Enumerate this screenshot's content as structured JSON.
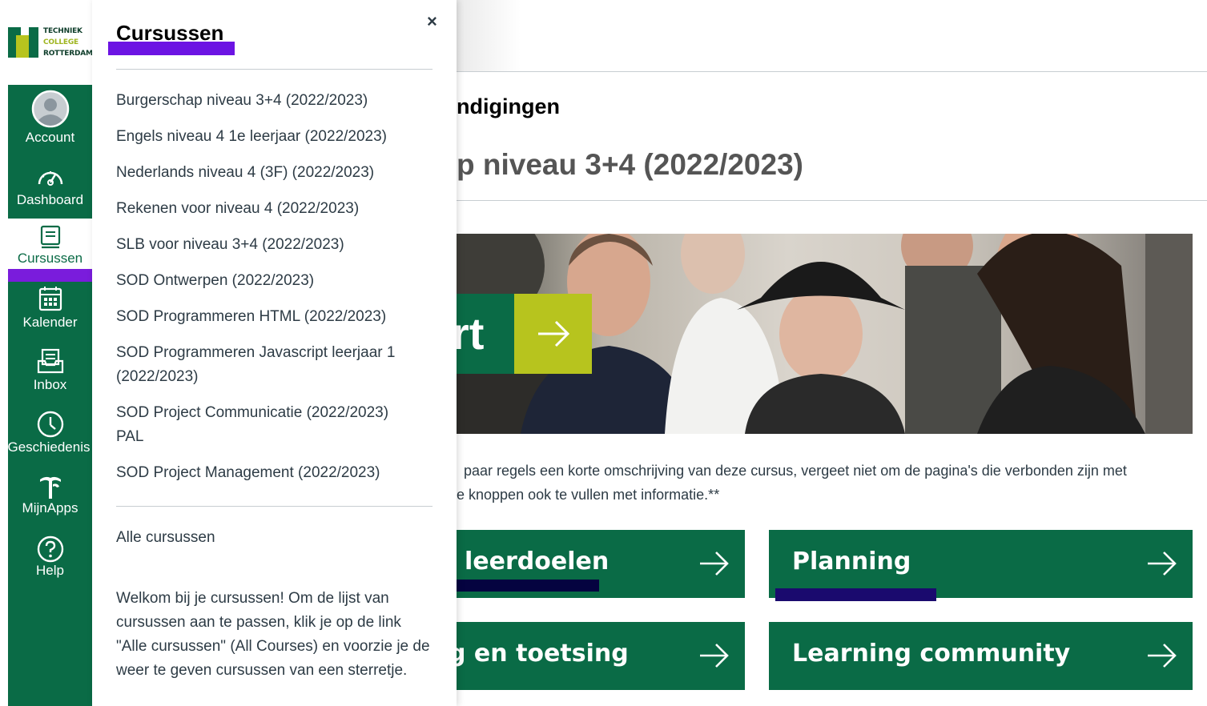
{
  "logo": {
    "line1": "TECHNIEK",
    "line2": "COLLEGE",
    "line3": "ROTTERDAM"
  },
  "nav": {
    "account": "Account",
    "dashboard": "Dashboard",
    "cursussen": "Cursussen",
    "kalender": "Kalender",
    "inbox": "Inbox",
    "geschiedenis": "Geschiedenis",
    "mijnapps": "MijnApps",
    "help": "Help"
  },
  "tray": {
    "title": "Cursussen",
    "close": "×",
    "courses": [
      "Burgerschap niveau 3+4 (2022/2023)",
      "Engels niveau 4 1e leerjaar (2022/2023)",
      "Nederlands niveau 4 (3F) (2022/2023)",
      "Rekenen voor niveau 4 (2022/2023)",
      "SLB voor niveau 3+4 (2022/2023)",
      "SOD Ontwerpen (2022/2023)",
      "SOD Programmeren HTML (2022/2023)",
      "SOD Programmeren Javascript leerjaar 1 (2022/2023)",
      "SOD Project Communicatie (2022/2023) PAL",
      "SOD Project Management (2022/2023)"
    ],
    "all_courses": "Alle cursussen",
    "info": "Welkom bij je cursussen! Om de lijst van cursussen aan te passen, klik je op de link \"Alle cursussen\" (All Courses) en voorzie je de weer te geven cursussen van een sterretje."
  },
  "main": {
    "announcements_heading": "ndigingen",
    "course_heading": "p niveau 3+4 (2022/2023)",
    "banner_text": "rt",
    "desc_line1": "paar regels een korte omschrijving van deze cursus, vergeet niet om de pagina's die verbonden zijn met",
    "desc_line2": "e knoppen ook te vullen met informatie.**",
    "tiles": {
      "leerdoelen": "leerdoelen",
      "planning": "Planning",
      "toetsing": "g en toetsing",
      "community": "Learning community"
    }
  },
  "colors": {
    "brand_green": "#0a6b46",
    "brand_lime": "#b7c41e",
    "highlight_purple": "#6c14e3",
    "highlight_navy": "#050340"
  },
  "icons": [
    "avatar-icon",
    "dashboard-icon",
    "courses-icon",
    "calendar-icon",
    "inbox-icon",
    "history-icon",
    "apps-icon",
    "help-icon",
    "close-icon",
    "arrow-right-icon"
  ]
}
